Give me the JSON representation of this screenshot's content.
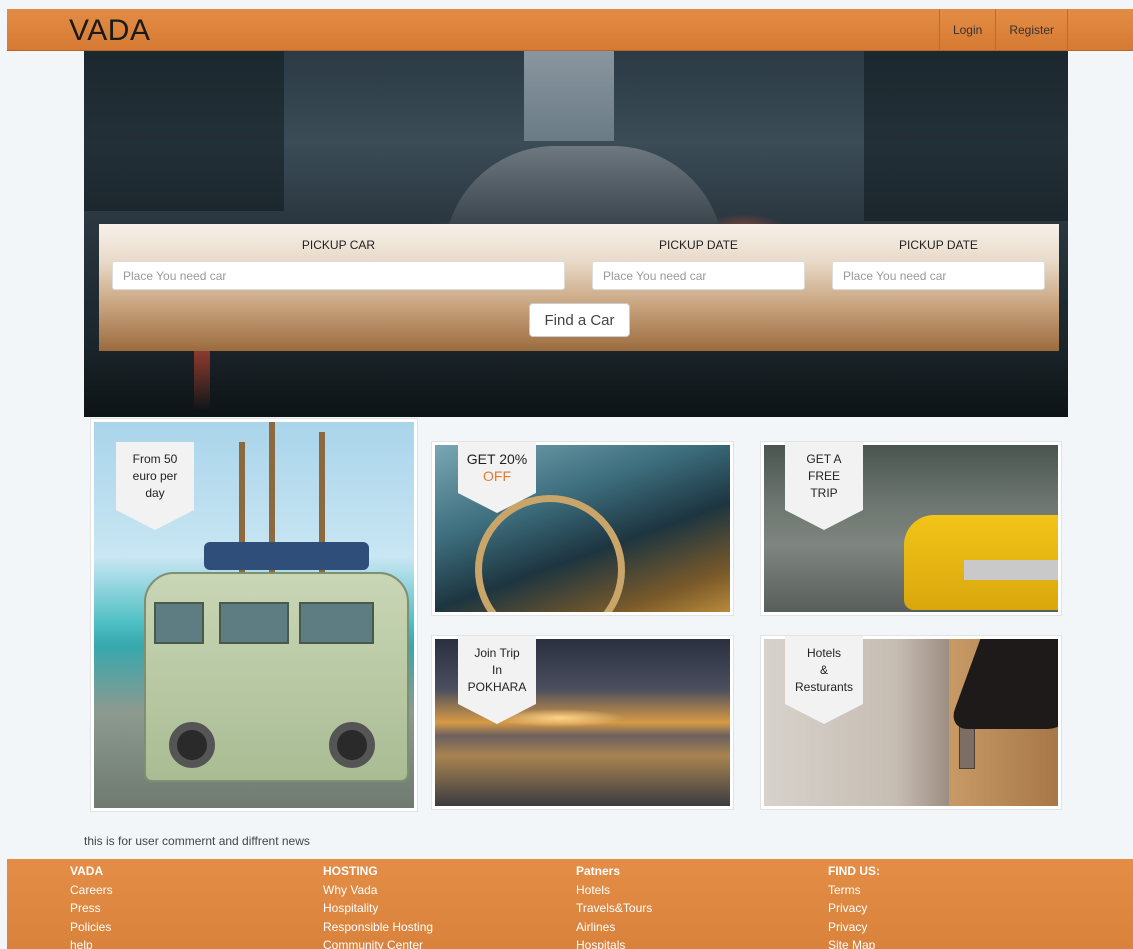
{
  "header": {
    "brand": "VADA",
    "nav": {
      "login": "Login",
      "register": "Register"
    }
  },
  "search": {
    "pickup_car_label": "PICKUP CAR",
    "pickup_date_label_1": "PICKUP DATE",
    "pickup_date_label_2": "PICKUP DATE",
    "placeholder_car": "Place You need car",
    "placeholder_date_1": "Place You need car",
    "placeholder_date_2": "Place You need car",
    "find_button": "Find a Car"
  },
  "cards": {
    "van": {
      "line1": "From 50",
      "line2": "euro per",
      "line3": "day"
    },
    "discount": {
      "line1": "GET 20%",
      "line2": "OFF"
    },
    "free_trip": {
      "line1": "GET A",
      "line2": "FREE",
      "line3": "TRIP"
    },
    "pokhara": {
      "line1": "Join Trip",
      "line2": "In",
      "line3": "POKHARA"
    },
    "hotels": {
      "line1": "Hotels",
      "line2": "&",
      "line3": "Resturants"
    }
  },
  "comment_text": "this is for user commernt and diffrent news",
  "footer": {
    "col1": {
      "heading": "VADA",
      "links": [
        "Careers",
        "Press",
        "Policies",
        "help"
      ]
    },
    "col2": {
      "heading": "HOSTING",
      "links": [
        "Why Vada",
        "Hospitality",
        "Responsible Hosting",
        "Community Center"
      ]
    },
    "col3": {
      "heading": "Patners",
      "links": [
        "Hotels",
        "Travels&Tours",
        "Airlines",
        "Hospitals"
      ]
    },
    "col4": {
      "heading": "FIND US:",
      "links": [
        "Terms",
        "Privacy",
        "Privacy",
        "Site Map"
      ]
    }
  },
  "colors": {
    "accent": "#e38c45",
    "offer": "#e07b32"
  },
  "icons": {
    "van_image": "van-photo",
    "dash_image": "dashboard-photo",
    "taxi_image": "taxi-photo",
    "lake_image": "lake-photo",
    "hotel_image": "hotel-photo"
  }
}
